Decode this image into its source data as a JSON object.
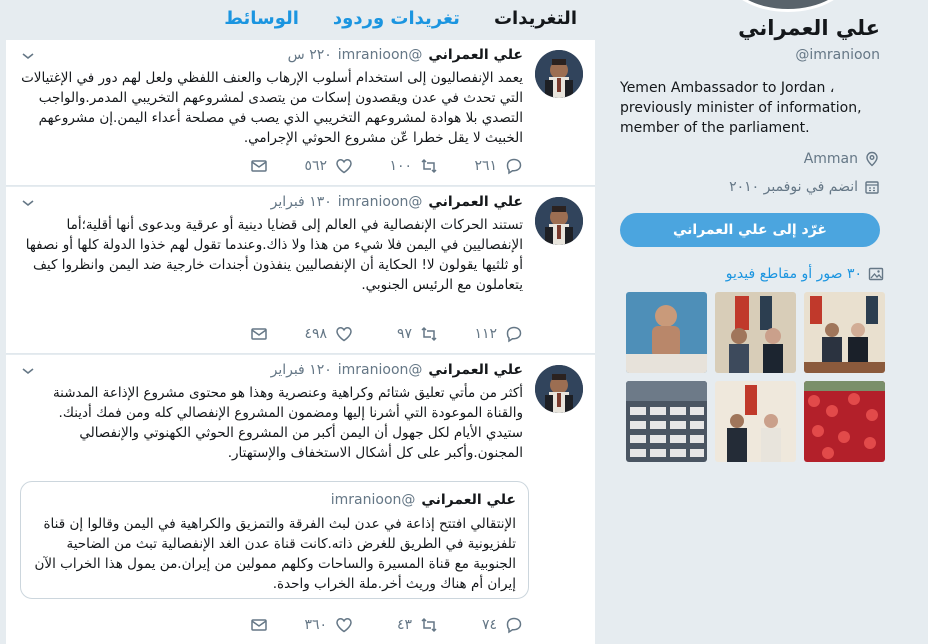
{
  "profile": {
    "name": "علي العمراني",
    "handle": "@imranioon",
    "bio": "Yemen Ambassador to Jordan ، previously minister of information, member of the parliament.",
    "location": "Amman",
    "joined": "انضم في نوفمبر ٢٠١٠",
    "tweet_to_label": "غرّد إلى علي العمراني",
    "media_label": "٣٠ صور أو مقاطع فيديو"
  },
  "tabs": [
    {
      "label": "التغريدات"
    },
    {
      "label": "تغريدات وردود"
    },
    {
      "label": "الوسائط"
    }
  ],
  "tweets": [
    {
      "name": "علي العمراني",
      "handle": "@imranioon",
      "time": "٢٢٠ س",
      "text": "يعمد الإنفصاليون إلى استخدام أسلوب الإرهاب والعنف اللفظي ولعل لهم دور في الإغتيالات التي تحدث في عدن ويقصدون إسكات من يتصدى لمشروعهم التخريبي المدمر.والواجب التصدي بلا هوادة لمشروعهم التخريبي الذي يصب في مصلحة أعداء اليمن.إن مشروعهم الخبيث لا يقل خطرا عّن مشروع الحوثي الإجرامي.",
      "replies": "٢٦١",
      "retweets": "١٠٠",
      "likes": "٥٦٢"
    },
    {
      "name": "علي العمراني",
      "handle": "@imranioon",
      "time": "١٣٠ فبراير",
      "text": "تستند الحركات الإنفصالية في العالم إلى قضايا دينية أو عرقية وبدعوى أنها أقلية؛أما الإنفصاليين في اليمن فلا شيء من هذا ولا ذاك.وعندما تقول لهم خذوا الدولة كلها أو نصفها أو ثلثيها يقولون لا! الحكاية أن الإنفصاليين ينفذون أجندات خارجية ضد اليمن وانظروا كيف يتعاملون مع الرئيس الجنوبي.",
      "replies": "١١٢",
      "retweets": "٩٧",
      "likes": "٤٩٨"
    },
    {
      "name": "علي العمراني",
      "handle": "@imranioon",
      "time": "١٢٠ فبراير",
      "text": "أكثر من مأتي تعليق شتائم وكراهية وعنصرية وهذا هو محتوى مشروع الإذاعة المدشنة والقناة الموعودة التي أشرنا إليها ومضمون المشروع الإنفصالي كله ومن فمك أدينك. ستيدي الأيام لكل جهول أن اليمن أكبر من المشروع الحوثي الكهنوتي والإنفصالي المجنون.وأكبر على كل أشكال الاستخفاف والإستهتار.",
      "quote_name": "علي العمراني",
      "quote_handle": "@imranioon",
      "quote_text": "الإنتقالي افتتح إذاعة في عدن لبث الفرقة والتمزيق والكراهية في اليمن وقالوا إن قناة تلفزيونية في الطريق للغرض ذاته.كانت قناة عدن الغد الإنفصالية تبث من الضاحية الجنوبية مع قناة المسيرة والساحات وكلهم ممولين من إيران.من يمول هذا الخراب الآن إيران أم هناك وريث أخر.ملة الخراب واحدة.",
      "replies": "٧٤",
      "retweets": "٤٣",
      "likes": "٣٦٠"
    }
  ],
  "colors": {
    "accent": "#1b95e0",
    "button": "#4ba5df",
    "background": "#e6ecf0",
    "muted": "#657786"
  }
}
